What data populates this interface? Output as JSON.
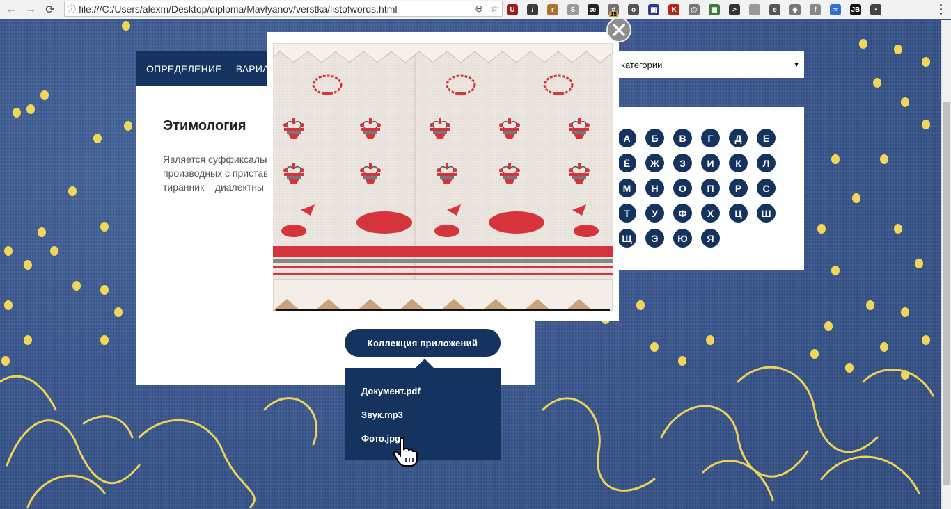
{
  "browser": {
    "url": "file:///C:/Users/alexm/Desktop/diploma/Mavlyanov/verstka/listofwords.html",
    "extension_badge": "15",
    "extensions": [
      {
        "name": "ublock-icon",
        "color": "#9b1c1c",
        "glyph": "U"
      },
      {
        "name": "eyedropper-icon",
        "color": "#3a3a3a",
        "glyph": "/"
      },
      {
        "name": "ruler-icon",
        "color": "#b07030",
        "glyph": "r"
      },
      {
        "name": "shield-icon",
        "color": "#9a9a9a",
        "glyph": "S"
      },
      {
        "name": "ae-icon",
        "color": "#222",
        "glyph": "æ"
      },
      {
        "name": "grid-icon",
        "color": "#707070",
        "glyph": "#"
      },
      {
        "name": "reel-icon",
        "color": "#555",
        "glyph": "o"
      },
      {
        "name": "screenshot-icon",
        "color": "#2b3b8f",
        "glyph": "▣"
      },
      {
        "name": "k-icon",
        "color": "#b3261e",
        "glyph": "K"
      },
      {
        "name": "swirl-icon",
        "color": "#777",
        "glyph": "@"
      },
      {
        "name": "color-icon",
        "color": "#3a7a3a",
        "glyph": "▦"
      },
      {
        "name": "terminal-icon",
        "color": "#333",
        "glyph": ">"
      },
      {
        "name": "gradient-icon",
        "color": "#999",
        "glyph": " "
      },
      {
        "name": "evernote-icon",
        "color": "#555",
        "glyph": "e"
      },
      {
        "name": "diamond-icon",
        "color": "#777",
        "glyph": "◆"
      },
      {
        "name": "font-icon",
        "color": "#888",
        "glyph": "f"
      },
      {
        "name": "sync-icon",
        "color": "#2f6fd6",
        "glyph": "≈"
      },
      {
        "name": "jb-icon",
        "color": "#111",
        "glyph": "JB"
      },
      {
        "name": "box-icon",
        "color": "#444",
        "glyph": "▪"
      }
    ]
  },
  "nav": {
    "tabs": [
      "Определение",
      "Вариант"
    ]
  },
  "article": {
    "title": "Этимология",
    "text_lines": [
      "Является суффиксальн",
      "производных с пристав",
      "тиранник – диалектны"
    ]
  },
  "category_select": {
    "label": "категории"
  },
  "alphabet": [
    "А",
    "Б",
    "В",
    "Г",
    "Д",
    "Е",
    "Ё",
    "Ж",
    "З",
    "И",
    "К",
    "Л",
    "М",
    "Н",
    "О",
    "П",
    "Р",
    "С",
    "Т",
    "У",
    "Ф",
    "Х",
    "Ц",
    "Ш",
    "Щ",
    "Э",
    "Ю",
    "Я"
  ],
  "collection": {
    "button_label": "Коллекция приложений",
    "items": [
      "Документ.pdf",
      "Звук.mp3",
      "Фото.jpg"
    ]
  },
  "colors": {
    "navy": "#14335e",
    "denim": "#3b5a8e",
    "embroidery_red": "#d6343c",
    "dot_yellow": "#f2d65a"
  }
}
